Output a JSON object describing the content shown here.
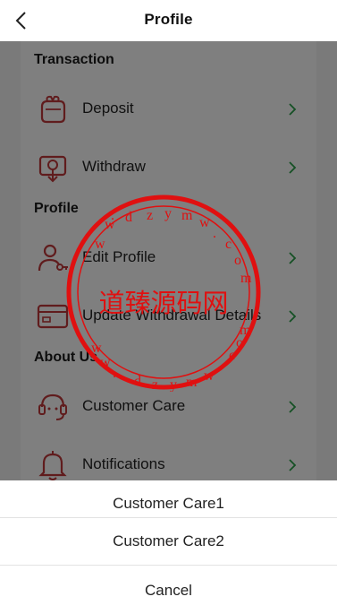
{
  "header": {
    "title": "Profile"
  },
  "sections": [
    {
      "title": "Transaction",
      "items": [
        {
          "label": "Deposit",
          "icon": "wallet-icon"
        },
        {
          "label": "Withdraw",
          "icon": "withdraw-icon"
        }
      ]
    },
    {
      "title": "Profile",
      "items": [
        {
          "label": "Edit Profile",
          "icon": "user-key-icon"
        },
        {
          "label": "Update Withdrawal Details",
          "icon": "card-icon"
        }
      ]
    },
    {
      "title": "About Us",
      "items": [
        {
          "label": "Customer Care",
          "icon": "headset-icon"
        },
        {
          "label": "Notifications",
          "icon": "bell-icon"
        }
      ]
    }
  ],
  "action_sheet": {
    "options": [
      "Customer Care1",
      "Customer Care2"
    ],
    "cancel": "Cancel"
  },
  "watermark": {
    "center_text": "道臻源码网",
    "ring_text": "www.dzymw.com"
  },
  "colors": {
    "accent": "#c0393b",
    "stamp": "#e01010",
    "overlay": "rgba(0,0,0,0.5)"
  }
}
